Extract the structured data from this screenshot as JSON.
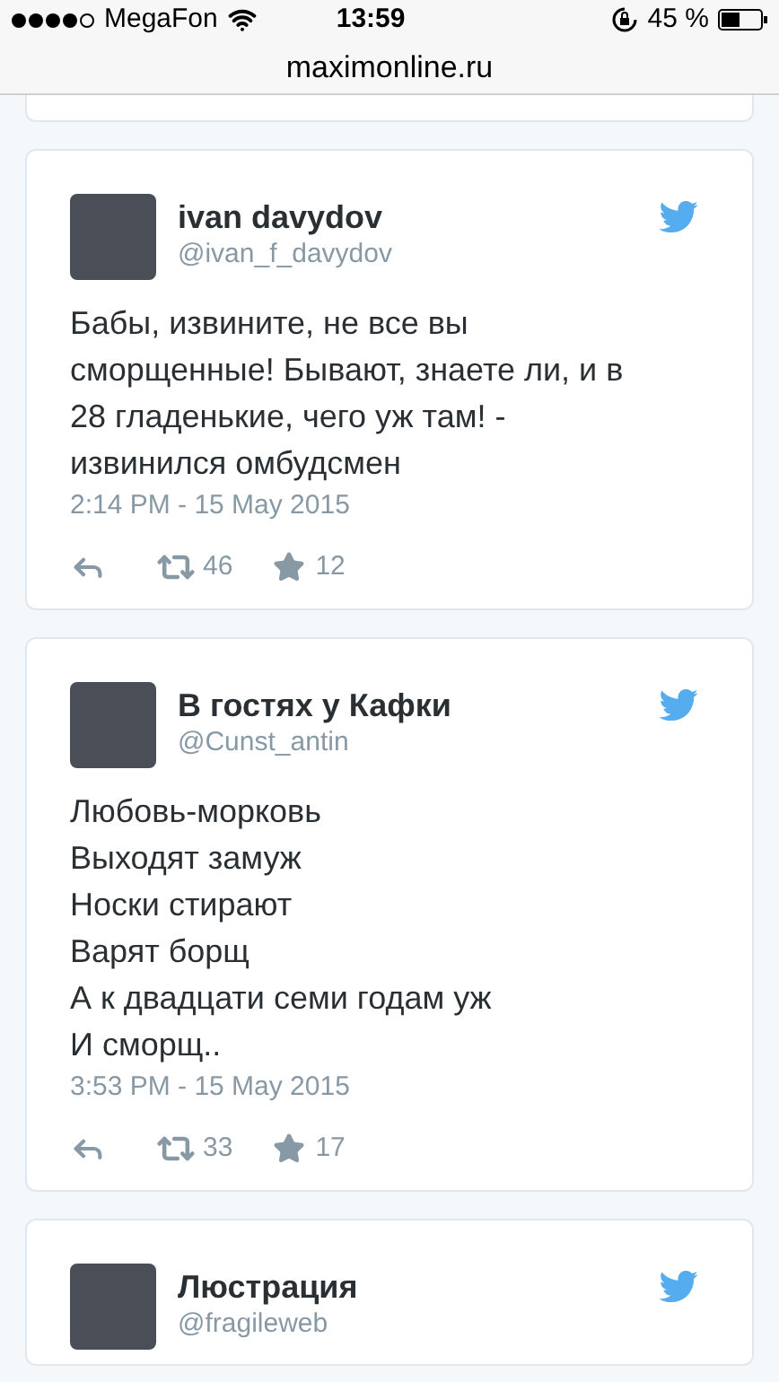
{
  "status_bar": {
    "carrier": "MegaFon",
    "time": "13:59",
    "battery": "45 %"
  },
  "address_bar": {
    "url": "maximonline.ru"
  },
  "tweets": [
    {
      "name": "ivan davydov",
      "handle": "@ivan_f_davydov",
      "text": "Бабы, извините, не все вы сморщенные! Бывают, знаете ли, и в 28 гладенькие, чего уж там! - извинился омбудсмен",
      "date": "2:14 PM - 15 May 2015",
      "retweets": "46",
      "favorites": "12"
    },
    {
      "name": "В гостях у Кафки",
      "handle": "@Cunst_antin",
      "text": "Любовь-морковь\nВыходят замуж\nНоски стирают\nВарят борщ\nА к двадцати семи годам уж\nИ сморщ..",
      "date": "3:53 PM - 15 May 2015",
      "retweets": "33",
      "favorites": "17"
    },
    {
      "name": "Люстрация",
      "handle": "@fragileweb"
    }
  ]
}
